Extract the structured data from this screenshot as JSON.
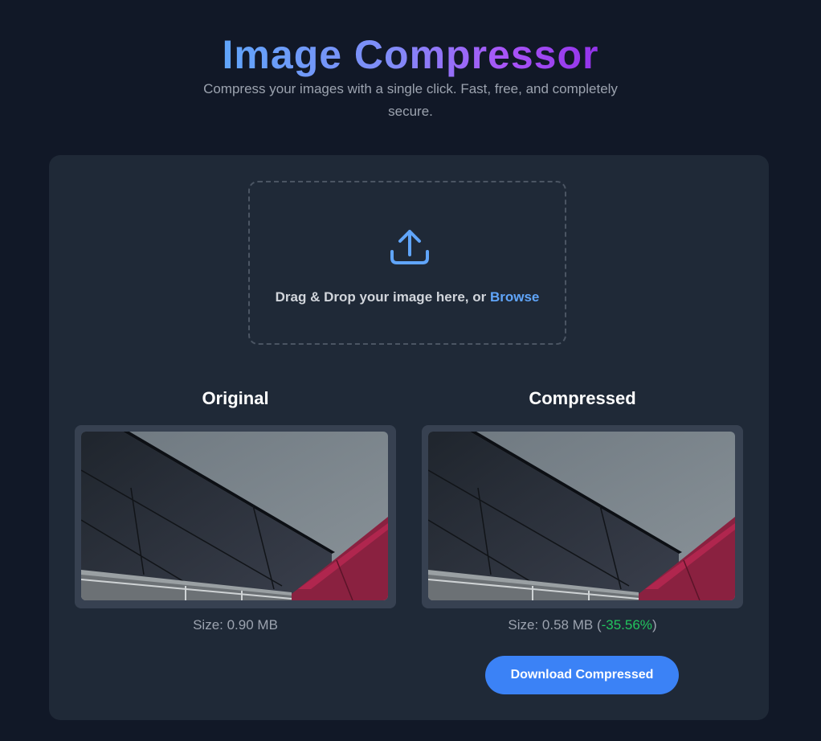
{
  "header": {
    "title": "Image Compressor",
    "subtitle": "Compress your images with a single click. Fast, free, and completely secure."
  },
  "dropzone": {
    "icon": "upload-icon",
    "text": "Drag & Drop your image here, or ",
    "browse_label": "Browse"
  },
  "original": {
    "heading": "Original",
    "size_label": "Size: 0.90 MB"
  },
  "compressed": {
    "heading": "Compressed",
    "size_prefix": "Size: 0.58 MB (",
    "reduction": "-35.56%",
    "size_suffix": ")",
    "download_label": "Download Compressed"
  },
  "colors": {
    "background": "#111827",
    "card": "#1f2937",
    "accent": "#3b82f6",
    "link": "#60a5fa",
    "success": "#22c55e"
  }
}
